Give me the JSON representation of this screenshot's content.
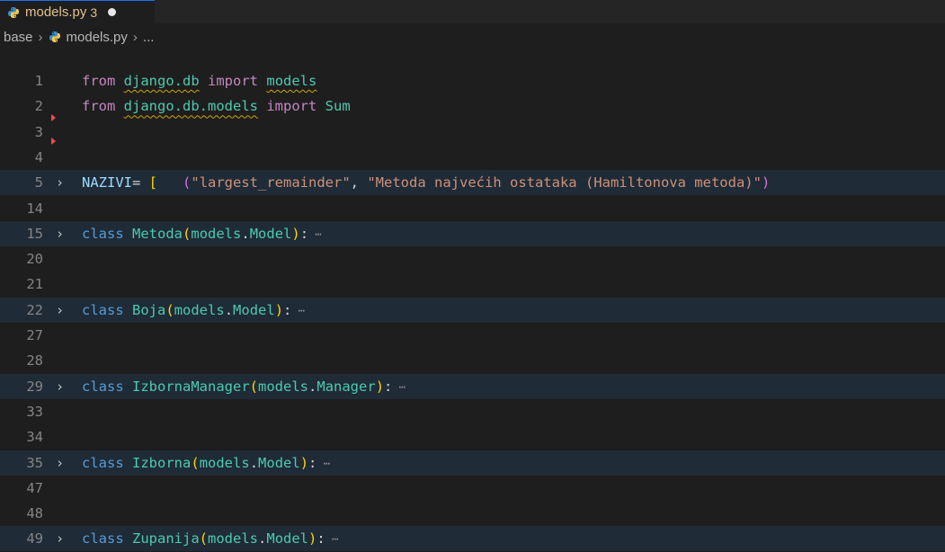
{
  "tab": {
    "filename": "models.py",
    "problem_count": "3",
    "icon": "python-icon"
  },
  "breadcrumb": {
    "folder": "base",
    "file": "models.py",
    "more": "..."
  },
  "colors": {
    "keyword": "#c586c0",
    "class": "#4ec9b0",
    "string": "#ce9178",
    "variable": "#9cdcfe",
    "line_number": "#858585",
    "folded_bg": "#1f2b37"
  },
  "lines": [
    {
      "n": "1",
      "parts": [
        [
          "kw",
          "from"
        ],
        [
          "op",
          " "
        ],
        [
          "mod squig",
          "django.db"
        ],
        [
          "op",
          " "
        ],
        [
          "kw",
          "import"
        ],
        [
          "op",
          " "
        ],
        [
          "mod squig",
          "models"
        ]
      ]
    },
    {
      "n": "2",
      "parts": [
        [
          "kw",
          "from"
        ],
        [
          "op",
          " "
        ],
        [
          "mod squig",
          "django.db.models"
        ],
        [
          "op",
          " "
        ],
        [
          "kw",
          "import"
        ],
        [
          "op",
          " "
        ],
        [
          "mod",
          "Sum"
        ]
      ]
    },
    {
      "n": "3",
      "parts": []
    },
    {
      "n": "4",
      "parts": []
    },
    {
      "n": "5",
      "fold": true,
      "parts": [
        [
          "var",
          "NAZIVI"
        ],
        [
          "op",
          "= "
        ],
        [
          "brk",
          "["
        ],
        [
          "op",
          "   "
        ],
        [
          "paren2",
          "("
        ],
        [
          "str",
          "\"largest_remainder\""
        ],
        [
          "op",
          ", "
        ],
        [
          "str",
          "\"Metoda najvećih ostataka (Hamiltonova metoda)\""
        ],
        [
          "paren2",
          ")"
        ]
      ]
    },
    {
      "n": "14",
      "parts": []
    },
    {
      "n": "15",
      "fold": true,
      "parts": [
        [
          "kw2",
          "class"
        ],
        [
          "op",
          " "
        ],
        [
          "cls",
          "Metoda"
        ],
        [
          "paren",
          "("
        ],
        [
          "mod",
          "models"
        ],
        [
          "op",
          "."
        ],
        [
          "cls",
          "Model"
        ],
        [
          "paren",
          ")"
        ],
        [
          "op",
          ":"
        ],
        [
          "ell",
          " ⋯"
        ]
      ]
    },
    {
      "n": "20",
      "parts": []
    },
    {
      "n": "21",
      "parts": []
    },
    {
      "n": "22",
      "fold": true,
      "parts": [
        [
          "kw2",
          "class"
        ],
        [
          "op",
          " "
        ],
        [
          "cls",
          "Boja"
        ],
        [
          "paren",
          "("
        ],
        [
          "mod",
          "models"
        ],
        [
          "op",
          "."
        ],
        [
          "cls",
          "Model"
        ],
        [
          "paren",
          ")"
        ],
        [
          "op",
          ":"
        ],
        [
          "ell",
          " ⋯"
        ]
      ]
    },
    {
      "n": "27",
      "parts": []
    },
    {
      "n": "28",
      "parts": []
    },
    {
      "n": "29",
      "fold": true,
      "parts": [
        [
          "kw2",
          "class"
        ],
        [
          "op",
          " "
        ],
        [
          "cls",
          "IzbornaManager"
        ],
        [
          "paren",
          "("
        ],
        [
          "mod",
          "models"
        ],
        [
          "op",
          "."
        ],
        [
          "cls",
          "Manager"
        ],
        [
          "paren",
          ")"
        ],
        [
          "op",
          ":"
        ],
        [
          "ell",
          " ⋯"
        ]
      ]
    },
    {
      "n": "33",
      "parts": []
    },
    {
      "n": "34",
      "parts": []
    },
    {
      "n": "35",
      "fold": true,
      "parts": [
        [
          "kw2",
          "class"
        ],
        [
          "op",
          " "
        ],
        [
          "cls",
          "Izborna"
        ],
        [
          "paren",
          "("
        ],
        [
          "mod",
          "models"
        ],
        [
          "op",
          "."
        ],
        [
          "cls",
          "Model"
        ],
        [
          "paren",
          ")"
        ],
        [
          "op",
          ":"
        ],
        [
          "ell",
          " ⋯"
        ]
      ]
    },
    {
      "n": "47",
      "parts": []
    },
    {
      "n": "48",
      "parts": []
    },
    {
      "n": "49",
      "fold": true,
      "parts": [
        [
          "kw2",
          "class"
        ],
        [
          "op",
          " "
        ],
        [
          "cls",
          "Zupanija"
        ],
        [
          "paren",
          "("
        ],
        [
          "mod",
          "models"
        ],
        [
          "op",
          "."
        ],
        [
          "cls",
          "Model"
        ],
        [
          "paren",
          ")"
        ],
        [
          "op",
          ":"
        ],
        [
          "ell",
          " ⋯"
        ]
      ]
    }
  ]
}
